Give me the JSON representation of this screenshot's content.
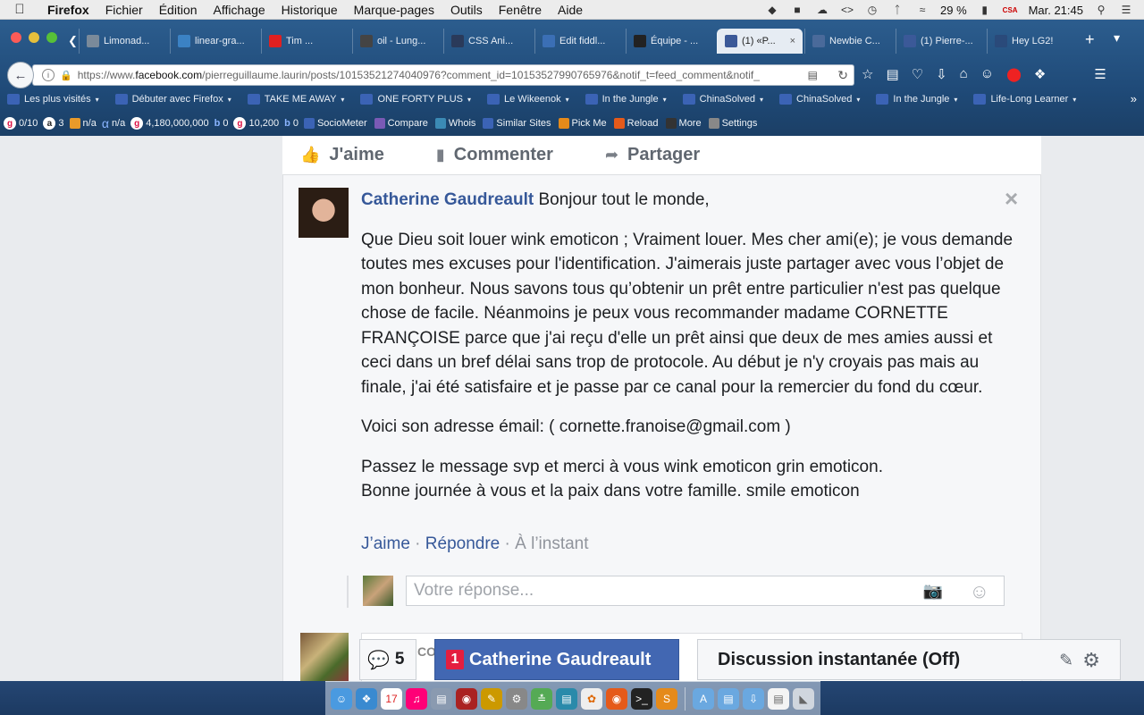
{
  "menubar": {
    "app": "Firefox",
    "items": [
      "Fichier",
      "Édition",
      "Affichage",
      "Historique",
      "Marque-pages",
      "Outils",
      "Fenêtre",
      "Aide"
    ],
    "battery": "29 %",
    "clock": "Mar. 21:45",
    "flag_label": "CSA"
  },
  "tabs": [
    {
      "label": "Limonad...",
      "color": "#7a8a9a"
    },
    {
      "label": "linear-gra...",
      "color": "#3b82c4"
    },
    {
      "label": "Tim ...",
      "color": "#e02020"
    },
    {
      "label": "oil - Lung...",
      "color": "#444444"
    },
    {
      "label": "CSS Ani...",
      "color": "#2a3a5a"
    },
    {
      "label": "Edit fiddl...",
      "color": "#3b6fb5"
    },
    {
      "label": "Équipe - ...",
      "color": "#222222"
    },
    {
      "label": "(1) «P...",
      "color": "#3b5998",
      "active": true
    },
    {
      "label": "Newbie C...",
      "color": "#4a6a9a"
    },
    {
      "label": "(1) Pierre-...",
      "color": "#3b5998"
    },
    {
      "label": "Hey LG2!",
      "color": "#2a4a7a"
    }
  ],
  "url": {
    "prefix": "https://www.",
    "domain": "facebook.com",
    "rest": "/pierreguillaume.laurin/posts/10153521274040976?comment_id=10153527990765976&notif_t=feed_comment&notif_"
  },
  "bookmarks": [
    "Les plus visités",
    "Débuter avec Firefox",
    "TAKE ME AWAY",
    "ONE FORTY PLUS",
    "Le Wikeenok",
    "In the Jungle",
    "ChinaSolved",
    "ChinaSolved",
    "In the Jungle",
    "Life-Long Learner"
  ],
  "addons": {
    "pr": "0/10",
    "alexa": "3",
    "compete": "n/a",
    "quantcast": "n/a",
    "google_index": "4,180,000,000",
    "bing_index": "0",
    "google_links": "10,200",
    "bing_links": "0",
    "tools": [
      "SocioMeter",
      "Compare",
      "Whois",
      "Similar Sites",
      "Pick Me",
      "Reload",
      "More",
      "Settings"
    ]
  },
  "actions": {
    "like": "J'aime",
    "comment": "Commenter",
    "share": "Partager"
  },
  "comment": {
    "author": "Catherine Gaudreault",
    "first_line": "Bonjour tout le monde,",
    "para1": "Que Dieu soit louer wink emoticon ; Vraiment louer. Mes cher ami(e); je vous demande toutes mes excuses pour l'identification. J'aimerais juste partager avec vous l’objet de mon bonheur. Nous savons tous qu’obtenir un prêt entre particulier n'est pas quelque chose de facile. Néanmoins je peux vous recommander madame CORNETTE FRANÇOISE parce que j'ai reçu d'elle un prêt ainsi que deux de mes amies aussi et ceci dans un bref délai sans trop de protocole. Au début je n'y croyais pas mais au finale, j'ai été satisfaire et je passe par ce canal pour la remercier du fond du cœur.",
    "para2": "Voici son adresse émail: ( cornette.franoise@gmail.com )",
    "para3a": "Passez le message svp et merci à vous wink emoticon grin emoticon.",
    "para3b": "Bonne journée à vous et la paix dans votre famille. smile emoticon",
    "like_link": "J’aime",
    "reply_link": "Répondre",
    "time": "À l’instant",
    "sep": " · "
  },
  "reply": {
    "placeholder": "Votre réponse..."
  },
  "next_comment_stub": "CO",
  "chat": {
    "count": "5",
    "badge": "1",
    "conversation": "Catherine Gaudreault",
    "status": "Discussion instantanée (Off)"
  }
}
